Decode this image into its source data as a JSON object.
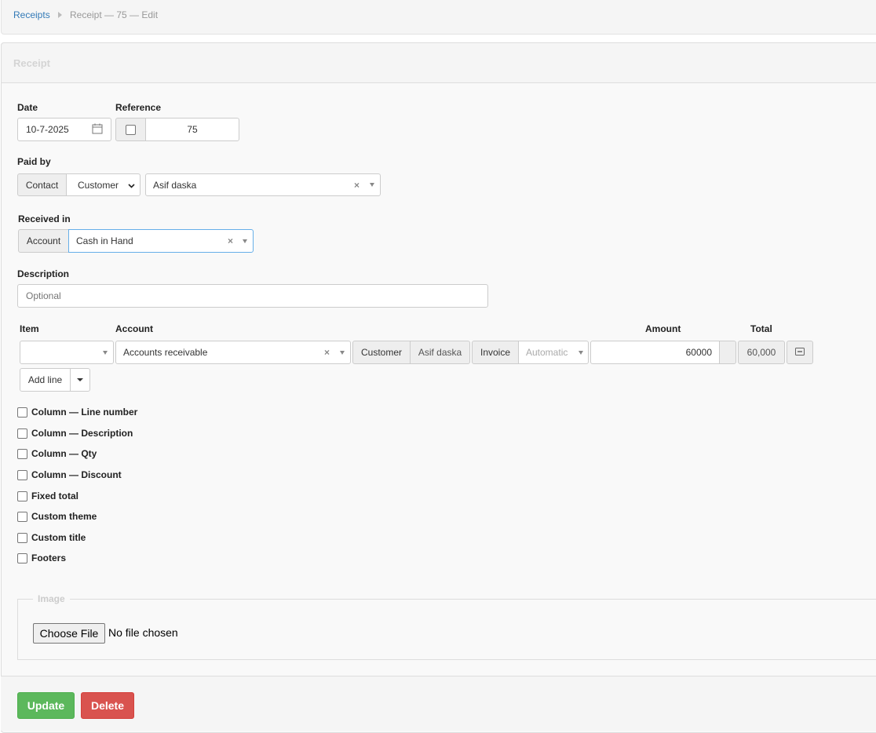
{
  "breadcrumb": {
    "link": "Receipts",
    "current": "Receipt — 75 — Edit"
  },
  "panel": {
    "title": "Receipt"
  },
  "form": {
    "date_label": "Date",
    "date_value": "10-7-2025",
    "reference_label": "Reference",
    "reference_value": "75",
    "paid_by_label": "Paid by",
    "paid_by_addon": "Contact",
    "paid_by_type": "Customer",
    "paid_by_contact": "Asif daska",
    "received_in_label": "Received in",
    "received_in_addon": "Account",
    "received_in_value": "Cash in Hand",
    "description_label": "Description",
    "description_placeholder": "Optional"
  },
  "lines": {
    "headers": {
      "item": "Item",
      "account": "Account",
      "amount": "Amount",
      "total": "Total"
    },
    "rows": [
      {
        "item": "",
        "account": "Accounts receivable",
        "customer_addon": "Customer",
        "customer": "Asif daska",
        "invoice_addon": "Invoice",
        "invoice_placeholder": "Automatic",
        "amount": "60000",
        "total": "60,000"
      }
    ],
    "add_line_label": "Add line"
  },
  "options": [
    "Column — Line number",
    "Column — Description",
    "Column — Qty",
    "Column — Discount",
    "Fixed total",
    "Custom theme",
    "Custom title",
    "Footers"
  ],
  "image": {
    "legend": "Image",
    "choose_file": "Choose File",
    "status": "No file chosen"
  },
  "actions": {
    "update": "Update",
    "delete": "Delete"
  },
  "colors": {
    "link": "#337ab7",
    "update": "#5cb85c",
    "delete": "#d9534f"
  }
}
